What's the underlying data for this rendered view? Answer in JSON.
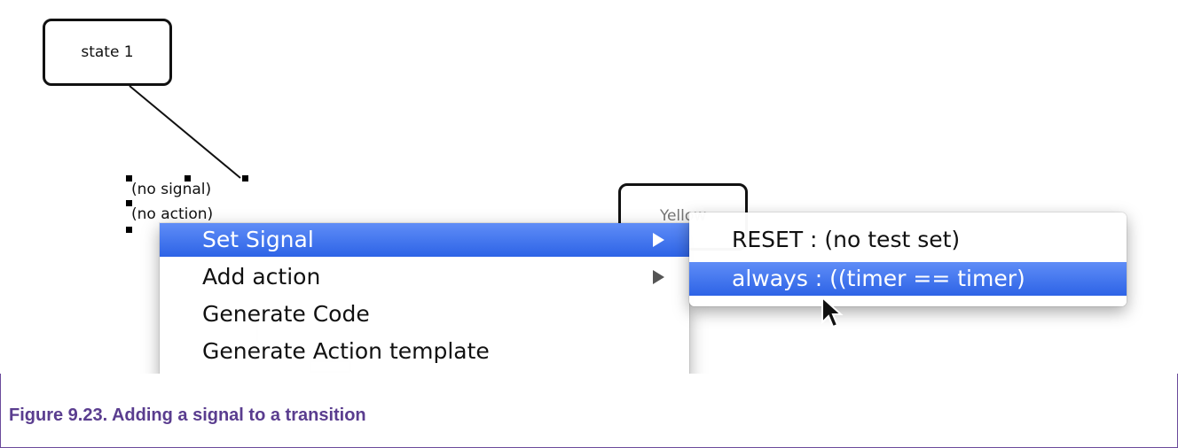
{
  "diagram": {
    "state1_label": "state 1",
    "state2_label": "Yellow",
    "transition_signal": "(no signal)",
    "transition_action": "(no action)"
  },
  "context_menu": {
    "items": [
      {
        "label": "Set Signal",
        "has_submenu": true,
        "selected": true
      },
      {
        "label": "Add action",
        "has_submenu": true,
        "selected": false
      },
      {
        "label": "Generate Code",
        "has_submenu": false,
        "selected": false
      },
      {
        "label": "Generate Action template",
        "has_submenu": false,
        "selected": false
      }
    ]
  },
  "submenu": {
    "items": [
      {
        "label": "RESET : (no test set)",
        "selected": false
      },
      {
        "label": "always : ((timer == timer)",
        "selected": true
      }
    ]
  },
  "caption": "Figure 9.23. Adding a signal to a transition",
  "colors": {
    "highlight": "#3a6ef0",
    "caption": "#5a3d8f",
    "frame": "#6b4a9b"
  }
}
